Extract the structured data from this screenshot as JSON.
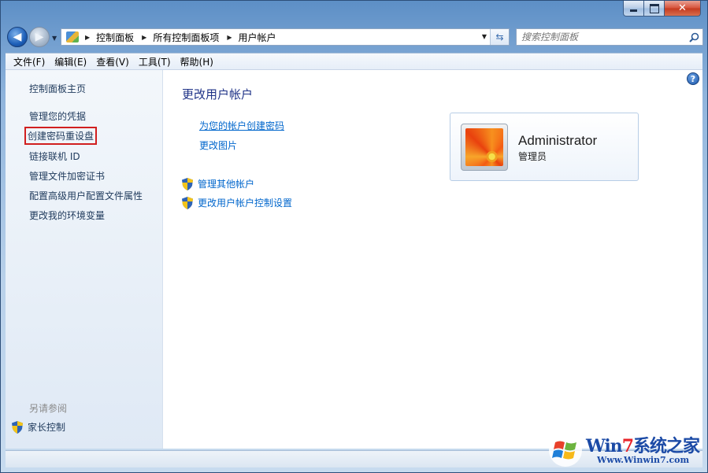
{
  "address_bar": {
    "breadcrumbs": [
      "控制面板",
      "所有控制面板项",
      "用户帐户"
    ]
  },
  "search": {
    "placeholder": "搜索控制面板"
  },
  "menu": [
    "文件(F)",
    "编辑(E)",
    "查看(V)",
    "工具(T)",
    "帮助(H)"
  ],
  "left_pane": {
    "home": "控制面板主页",
    "links": [
      "管理您的凭据",
      "创建密码重设盘",
      "链接联机 ID",
      "管理文件加密证书",
      "配置高级用户配置文件属性",
      "更改我的环境变量"
    ],
    "highlighted_index": 1,
    "see_also": "另请参阅",
    "parental_controls": "家长控制"
  },
  "main": {
    "title": "更改用户帐户",
    "links": [
      "为您的帐户创建密码",
      "更改图片"
    ],
    "admin_links": [
      "管理其他帐户",
      "更改用户帐户控制设置"
    ]
  },
  "user": {
    "name": "Administrator",
    "role": "管理员"
  },
  "watermark": {
    "title_a": "Win",
    "title_seven": "7",
    "title_b": "系统之家",
    "url": "Www.Winwin7.com"
  },
  "colors": {
    "link": "#0066cc",
    "title": "#1e3287",
    "left_link": "#1e395b",
    "highlight_box": "#d11f1f"
  },
  "icons": {
    "back": "arrow-left-icon",
    "forward": "arrow-right-icon",
    "refresh": "refresh-icon",
    "search": "magnifier-icon",
    "help": "question-icon",
    "shield": "uac-shield-icon"
  }
}
